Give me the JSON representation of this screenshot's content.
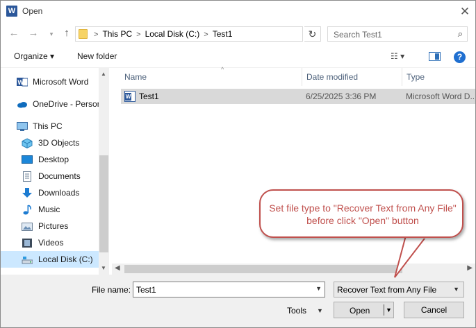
{
  "window": {
    "title": "Open",
    "app_icon_letter": "W",
    "close_glyph": "✕"
  },
  "nav": {
    "back": "←",
    "forward": "→",
    "recent": "▾",
    "up": "↑"
  },
  "address": {
    "crumbs": [
      "This PC",
      "Local Disk (C:)",
      "Test1"
    ],
    "separator": ">",
    "dropdown": "▾",
    "refresh": "↻"
  },
  "search": {
    "placeholder": "Search Test1",
    "icon": "search-icon"
  },
  "toolbar": {
    "organize_label": "Organize ▾",
    "new_folder_label": "New folder",
    "view_label": "☷ ▾",
    "help_label": "?"
  },
  "sidebar": {
    "items": [
      {
        "label": "Microsoft Word",
        "icon": "word-icon"
      },
      {
        "label": "OneDrive - Person",
        "icon": "onedrive-icon"
      },
      {
        "label": "This PC",
        "icon": "pc-icon"
      },
      {
        "label": "3D Objects",
        "icon": "3d-objects-icon"
      },
      {
        "label": "Desktop",
        "icon": "desktop-icon"
      },
      {
        "label": "Documents",
        "icon": "documents-icon"
      },
      {
        "label": "Downloads",
        "icon": "downloads-icon"
      },
      {
        "label": "Music",
        "icon": "music-icon"
      },
      {
        "label": "Pictures",
        "icon": "pictures-icon"
      },
      {
        "label": "Videos",
        "icon": "videos-icon"
      },
      {
        "label": "Local Disk (C:)",
        "icon": "local-disk-icon"
      }
    ],
    "selected": "Local Disk (C:)"
  },
  "filelist": {
    "columns": [
      "Name",
      "Date modified",
      "Type"
    ],
    "rows": [
      {
        "name": "Test1",
        "date": "6/25/2025 3:36 PM",
        "type": "Microsoft Word D..."
      }
    ]
  },
  "bottom": {
    "file_name_label": "File name:",
    "file_name_value": "Test1",
    "file_type_value": "Recover Text from Any File",
    "tools_label": "Tools",
    "open_label": "Open",
    "cancel_label": "Cancel"
  },
  "callout": {
    "text": "Set file type to \"Recover Text from Any File\" before click \"Open\" button",
    "color": "#c0504d"
  },
  "colors": {
    "selection": "#cce8ff",
    "selected_row": "#d9d9d9",
    "accent": "#1f6fd0"
  }
}
